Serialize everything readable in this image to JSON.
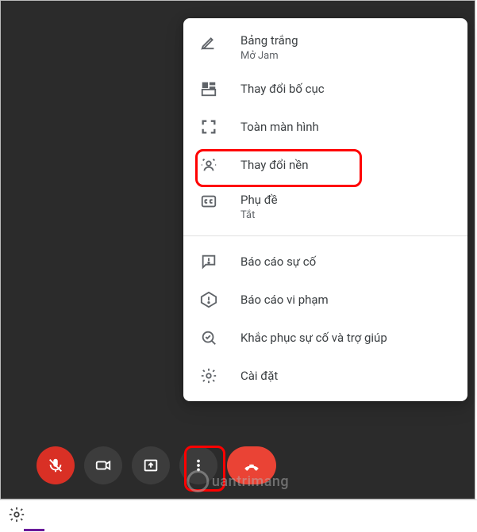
{
  "menu": {
    "whiteboard": {
      "label": "Bảng trắng",
      "sub": "Mở Jam"
    },
    "layout": {
      "label": "Thay đổi bố cục"
    },
    "fullscreen": {
      "label": "Toàn màn hình"
    },
    "background": {
      "label": "Thay đổi nền"
    },
    "captions": {
      "label": "Phụ đề",
      "sub": "Tắt"
    },
    "report_problem": {
      "label": "Báo cáo sự cố"
    },
    "report_abuse": {
      "label": "Báo cáo vi phạm"
    },
    "troubleshoot": {
      "label": "Khắc phục sự cố và trợ giúp"
    },
    "settings": {
      "label": "Cài đặt"
    }
  },
  "watermark": {
    "text": "uantrimang"
  }
}
